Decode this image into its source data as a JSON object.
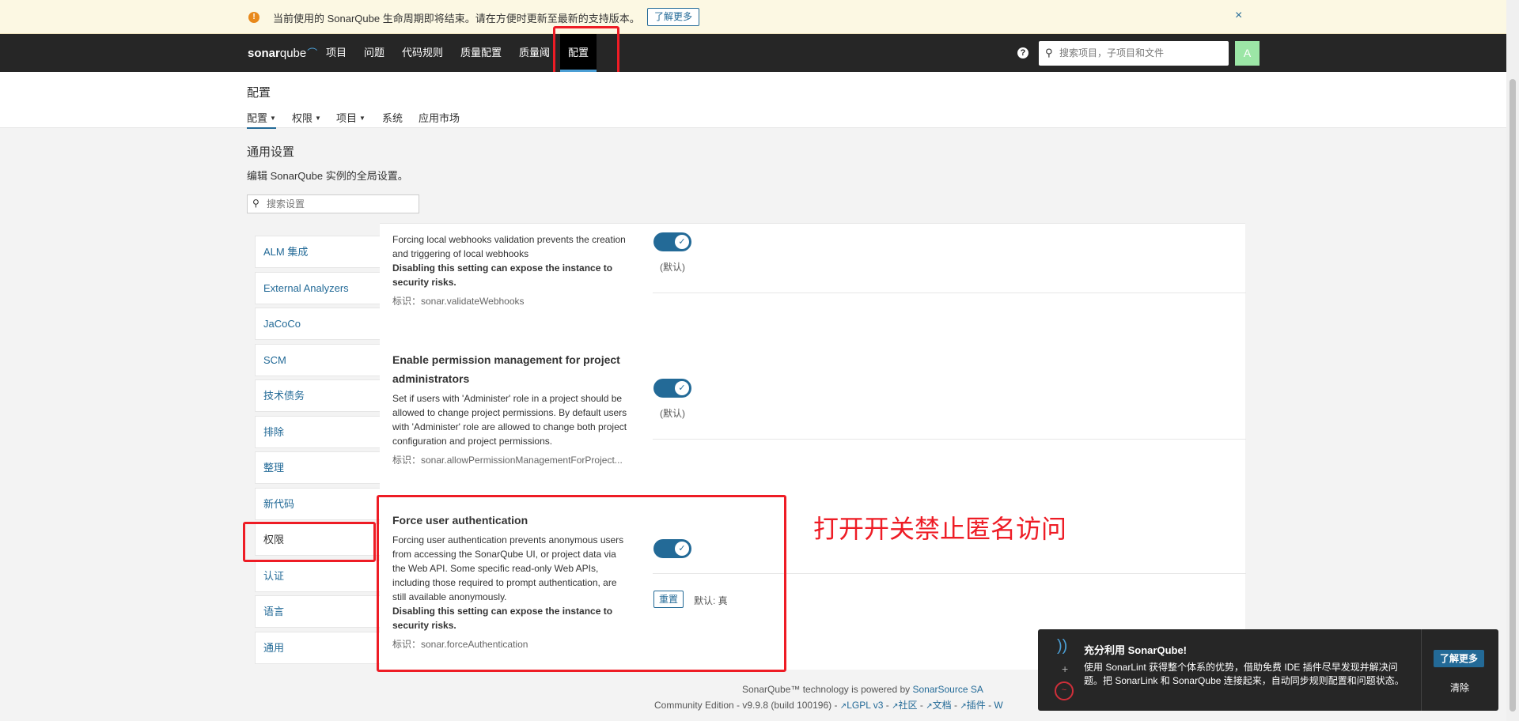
{
  "banner": {
    "message": "当前使用的 SonarQube 生命周期即将结束。请在方便时更新至最新的支持版本。",
    "learn_more": "了解更多",
    "close": "×"
  },
  "navbar": {
    "logo_prefix": "sonar",
    "logo_suffix": "qube",
    "items": [
      "项目",
      "问题",
      "代码规则",
      "质量配置",
      "质量阈",
      "配置"
    ],
    "active_item": "配置",
    "search_placeholder": "搜索项目，子项目和文件",
    "avatar_letter": "A",
    "help": "?"
  },
  "page": {
    "title": "配置",
    "subnav": [
      "配置",
      "权限",
      "项目",
      "系统",
      "应用市场"
    ]
  },
  "settings_header": {
    "title": "通用设置",
    "description": "编辑 SonarQube 实例的全局设置。",
    "search_placeholder": "搜索设置"
  },
  "sidebar": {
    "items": [
      "ALM 集成",
      "External Analyzers",
      "JaCoCo",
      "SCM",
      "技术债务",
      "排除",
      "整理",
      "新代码",
      "权限",
      "认证",
      "语言",
      "通用"
    ],
    "active": "权限"
  },
  "settings": [
    {
      "description": "Forcing local webhooks validation prevents the creation and triggering of local webhooks",
      "warning": "Disabling this setting can expose the instance to security risks.",
      "key": "标识：sonar.validateWebhooks",
      "default_note": "(默认)",
      "enabled": true
    },
    {
      "title": "Enable permission management for project administrators",
      "description": "Set if users with 'Administer' role in a project should be allowed to change project permissions. By default users with 'Administer' role are allowed to change both project configuration and project permissions.",
      "key": "标识：sonar.allowPermissionManagementForProject...",
      "default_note": "(默认)",
      "enabled": true
    },
    {
      "title": "Force user authentication",
      "description": "Forcing user authentication prevents anonymous users from accessing the SonarQube UI, or project data via the Web API. Some specific read-only Web APIs, including those required to prompt authentication, are still available anonymously.",
      "warning": "Disabling this setting can expose the instance to security risks.",
      "key": "标识：sonar.forceAuthentication",
      "reset_label": "重置",
      "default_note": "默认: 真",
      "enabled": true
    }
  ],
  "annotation": "打开开关禁止匿名访问",
  "footer": {
    "powered_prefix": "SonarQube™ technology is powered by",
    "powered_link": "SonarSource SA",
    "edition": "Community Edition - v9.9.8 (build 100196) -",
    "license": "LGPL v3",
    "community": "社区",
    "docs": "文档",
    "plugins": "插件",
    "separator": "-",
    "truncated": "W"
  },
  "toast": {
    "title": "充分利用 SonarQube!",
    "body": "使用 SonarLint 获得整个体系的优势，借助免费 IDE 插件尽早发现并解决问题。把 SonarLink 和 SonarQube 连接起来，自动同步规则配置和问题状态。",
    "learn_more": "了解更多",
    "dismiss": "清除"
  },
  "colors": {
    "accent": "#236a97",
    "nav_bg": "#262626",
    "banner_bg": "#fcf8e3",
    "annotation_red": "#ee1c25",
    "avatar_bg": "#9ce6a6"
  }
}
